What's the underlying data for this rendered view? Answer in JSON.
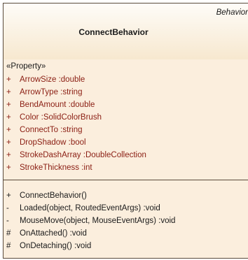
{
  "class": {
    "stereotype": "Behavior",
    "name": "ConnectBehavior"
  },
  "attributes": {
    "section_label": "«Property»",
    "items": [
      {
        "visibility": "+",
        "text": "ArrowSize :double"
      },
      {
        "visibility": "+",
        "text": "ArrowType :string"
      },
      {
        "visibility": "+",
        "text": "BendAmount :double"
      },
      {
        "visibility": "+",
        "text": "Color :SolidColorBrush"
      },
      {
        "visibility": "+",
        "text": "ConnectTo :string"
      },
      {
        "visibility": "+",
        "text": "DropShadow :bool"
      },
      {
        "visibility": "+",
        "text": "StrokeDashArray :DoubleCollection"
      },
      {
        "visibility": "+",
        "text": "StrokeThickness :int"
      }
    ]
  },
  "operations": {
    "items": [
      {
        "visibility": "+",
        "text": "ConnectBehavior()"
      },
      {
        "visibility": "-",
        "text": "Loaded(object, RoutedEventArgs) :void"
      },
      {
        "visibility": "-",
        "text": "MouseMove(object, MouseEventArgs) :void"
      },
      {
        "visibility": "#",
        "text": "OnAttached() :void"
      },
      {
        "visibility": "#",
        "text": "OnDetaching() :void"
      }
    ]
  },
  "colors": {
    "border": "#5a4a3a",
    "header_top": "#fefcf8",
    "header_bottom": "#f7e8cf",
    "body_fill": "#fbeedd",
    "attribute_text": "#8a1d12",
    "operation_text": "#1a1a1a"
  }
}
